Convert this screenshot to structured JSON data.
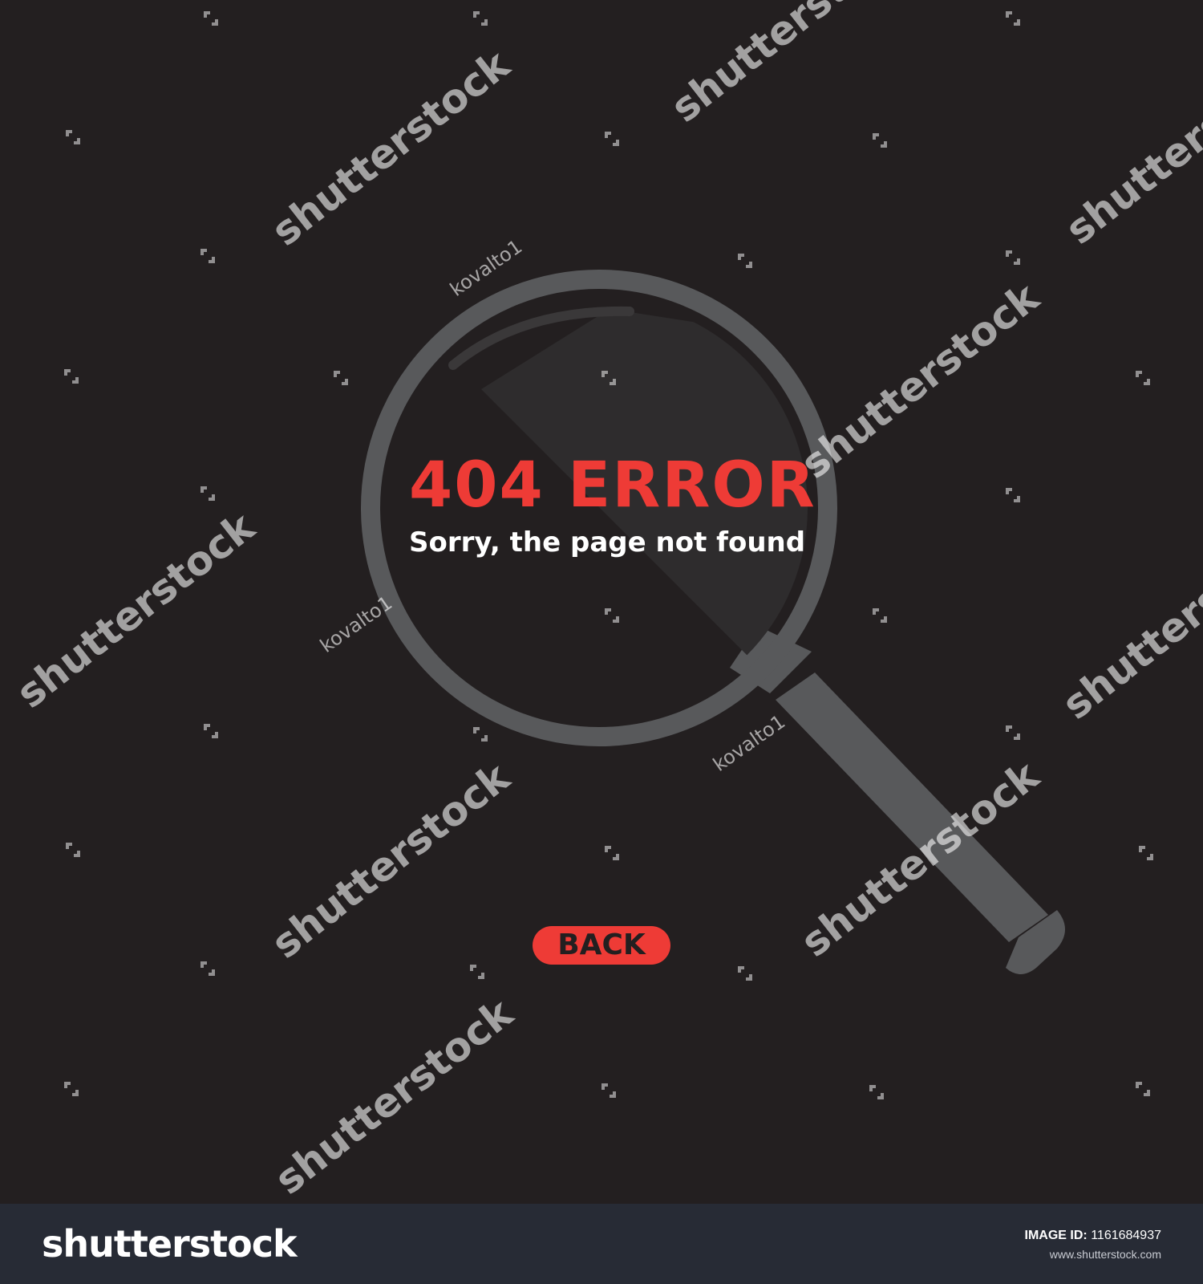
{
  "error": {
    "code": "404 ERROR",
    "message": "Sorry, the page not found"
  },
  "actions": {
    "back_label": "BACK"
  },
  "watermark": {
    "text": "shutterstock",
    "author": "kovalto1"
  },
  "footer": {
    "brand": "shutterstock",
    "image_id_label": "IMAGE ID:",
    "image_id": "1161684937",
    "url": "www.shutterstock.com"
  },
  "colors": {
    "background": "#231f20",
    "accent": "#ee3b36",
    "magnifier": "#58595b",
    "footer": "#272b35",
    "text": "#ffffff"
  },
  "icons": [
    "magnifying-glass-icon",
    "watermark-logo-icon"
  ]
}
